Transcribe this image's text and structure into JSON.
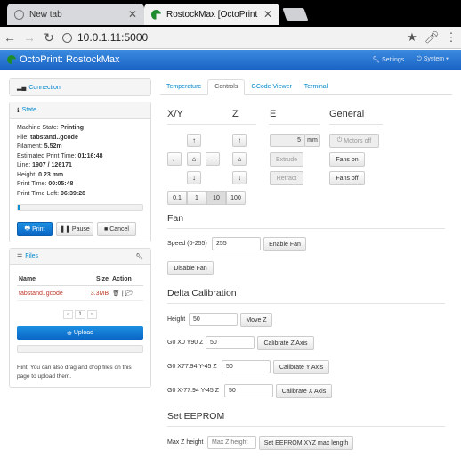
{
  "browser": {
    "tab1_title": "New tab",
    "tab2_title": "RostockMax [OctoPrint",
    "url": "10.0.1.11:5000",
    "close": "✕"
  },
  "app": {
    "brand": "OctoPrint: RostockMax",
    "settings": "Settings",
    "system": "System"
  },
  "sidebar": {
    "connection_title": "Connection",
    "state_title": "State",
    "state_rows": [
      {
        "label": "Machine State: ",
        "value": "Printing"
      },
      {
        "label": "File: ",
        "value": "tabstand..gcode"
      },
      {
        "label": "Filament: ",
        "value": "5.52m"
      },
      {
        "label": "Estimated Print Time: ",
        "value": "01:16:48"
      },
      {
        "label": "Line: ",
        "value": "1907 / 126171"
      },
      {
        "label": "Height: ",
        "value": "0.23 mm"
      },
      {
        "label": "Print Time: ",
        "value": "00:05:48"
      },
      {
        "label": "Print Time Left: ",
        "value": "06:39:28"
      }
    ],
    "progress_fraction": 0.02,
    "print_btn": "Print",
    "pause_btn": "Pause",
    "cancel_btn": "Cancel",
    "files_title": "Files",
    "files_headers": {
      "name": "Name",
      "size": "Size",
      "action": "Action"
    },
    "files": [
      {
        "name": "tabstand..gcode",
        "size": "3.3MB"
      }
    ],
    "pager": {
      "prev": "«",
      "page": "1",
      "next": "»"
    },
    "upload_btn": "Upload",
    "hint": "Hint: You can also drag and drop files on this page to upload them."
  },
  "main": {
    "tabs": [
      "Temperature",
      "Controls",
      "GCode Viewer",
      "Terminal"
    ],
    "active_tab": "Controls",
    "xy_label": "X/Y",
    "z_label": "Z",
    "e_label": "E",
    "general_label": "General",
    "steps": [
      "0.1",
      "1",
      "10",
      "100"
    ],
    "extrude_amount": "5",
    "extrude_unit": "mm",
    "extrude_btn": "Extrude",
    "retract_btn": "Retract",
    "motors_off_btn": "Motors off",
    "fans_on_btn": "Fans on",
    "fans_off_btn": "Fans off",
    "fan_title": "Fan",
    "fan_speed_label": "Speed (0-255)",
    "fan_speed_value": "255",
    "enable_fan_btn": "Enable Fan",
    "disable_fan_btn": "Disable Fan",
    "delta_title": "Delta Calibration",
    "height_label": "Height",
    "height_value": "50",
    "movez_btn": "Move Z",
    "zaxis_label": "G0 X0 Y90 Z",
    "zaxis_value": "50",
    "zaxis_btn": "Calibrate Z Axis",
    "yaxis_label": "G0 X77.94 Y-45 Z",
    "yaxis_value": "50",
    "yaxis_btn": "Calibrate Y Axis",
    "xaxis_label": "G0 X-77.94 Y-45 Z",
    "xaxis_value": "50",
    "xaxis_btn": "Calibrate X Axis",
    "eeprom_title": "Set EEPROM",
    "maxz_label": "Max Z height",
    "maxz_placeholder": "Max Z height",
    "eeprom_btn": "Set EEPROM XYZ max length"
  }
}
